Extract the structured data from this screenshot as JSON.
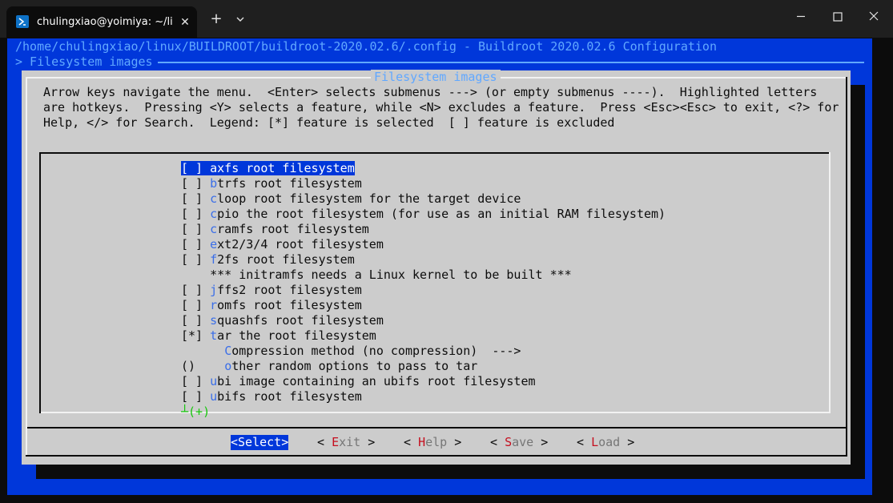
{
  "window": {
    "tab_title": "chulingxiao@yoimiya: ~/linux",
    "tab_close": "✕",
    "new_tab": "+",
    "icons": [
      "powershell-icon",
      "close-icon",
      "plus-icon",
      "chevron-down-icon",
      "minimize-icon",
      "maximize-icon",
      "close-icon"
    ]
  },
  "header": {
    "path_line": "/home/chulingxiao/linux/BUILDROOT/buildroot-2020.02.6/.config - Buildroot 2020.02.6 Configuration",
    "breadcrumb": "> Filesystem images"
  },
  "dialog": {
    "title": "Filesystem images",
    "help_lines": [
      "Arrow keys navigate the menu.  <Enter> selects submenus ---> (or empty submenus ----).  Highlighted letters",
      "are hotkeys.  Pressing <Y> selects a feature, while <N> excludes a feature.  Press <Esc><Esc> to exit, <?> for",
      "Help, </> for Search.  Legend: [*] feature is selected  [ ] feature is excluded"
    ],
    "items": [
      {
        "prefix": "[ ] ",
        "hotkey": "a",
        "rest": "xfs root filesystem"
      },
      {
        "prefix": "[ ] ",
        "hotkey": "b",
        "rest": "trfs root filesystem"
      },
      {
        "prefix": "[ ] ",
        "hotkey": "c",
        "rest": "loop root filesystem for the target device"
      },
      {
        "prefix": "[ ] ",
        "hotkey": "c",
        "rest": "pio the root filesystem (for use as an initial RAM filesystem)"
      },
      {
        "prefix": "[ ] ",
        "hotkey": "c",
        "rest": "ramfs root filesystem"
      },
      {
        "prefix": "[ ] ",
        "hotkey": "e",
        "rest": "xt2/3/4 root filesystem"
      },
      {
        "prefix": "[ ] ",
        "hotkey": "f",
        "rest": "2fs root filesystem"
      },
      {
        "prefix": "    ",
        "hotkey": "",
        "rest": "*** initramfs needs a Linux kernel to be built ***"
      },
      {
        "prefix": "[ ] ",
        "hotkey": "j",
        "rest": "ffs2 root filesystem"
      },
      {
        "prefix": "[ ] ",
        "hotkey": "r",
        "rest": "omfs root filesystem"
      },
      {
        "prefix": "[ ] ",
        "hotkey": "s",
        "rest": "quashfs root filesystem"
      },
      {
        "prefix": "[*] ",
        "hotkey": "t",
        "rest": "ar the root filesystem"
      },
      {
        "prefix": "      ",
        "hotkey": "C",
        "rest": "ompression method (no compression)  --->"
      },
      {
        "prefix": "()    ",
        "hotkey": "o",
        "rest": "ther random options to pass to tar"
      },
      {
        "prefix": "[ ] ",
        "hotkey": "u",
        "rest": "bi image containing an ubifs root filesystem"
      },
      {
        "prefix": "[ ] ",
        "hotkey": "u",
        "rest": "bifs root filesystem"
      }
    ],
    "more_indicator": "┴(+)",
    "buttons": {
      "select": "<Select>",
      "exit": {
        "left": "< ",
        "hotkey": "E",
        "rest": "xit",
        "right": " >"
      },
      "help": {
        "left": "< ",
        "hotkey": "H",
        "rest": "elp",
        "right": " >"
      },
      "save": {
        "left": "< ",
        "hotkey": "S",
        "rest": "ave",
        "right": " >"
      },
      "load": {
        "left": "< ",
        "hotkey": "L",
        "rest": "oad",
        "right": " >"
      }
    }
  },
  "colors": {
    "terminal_bg": "#0c0c0c",
    "screen_blue": "#0037da",
    "dialog_grey": "#cccccc",
    "title_cyan": "#61a8ff",
    "hotkey_blue": "#3a6ee8",
    "hotkey_red": "#c50f1f",
    "more_green": "#16c60c"
  }
}
